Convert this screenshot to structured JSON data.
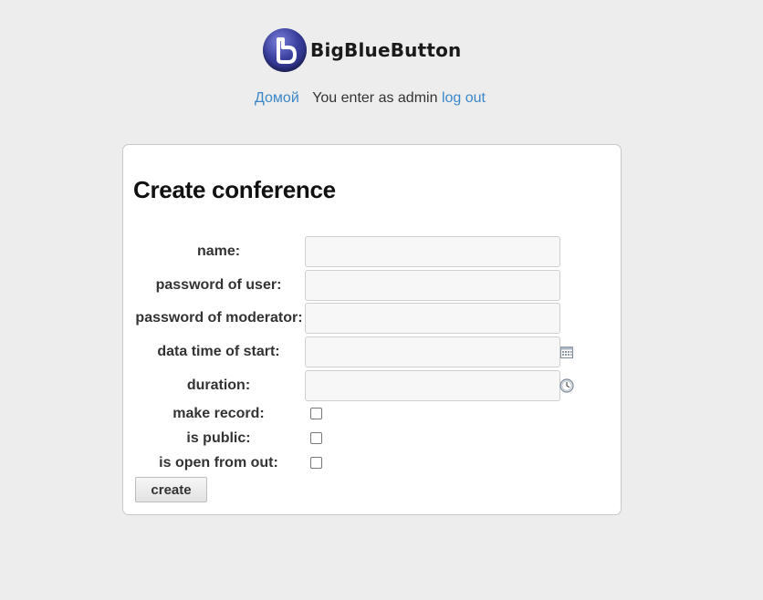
{
  "header": {
    "brand": "BigBlueButton",
    "logo_icon": "bigbluebutton-logo-icon"
  },
  "userbar": {
    "home_link": "Домой",
    "message": "You enter as admin",
    "logout_link": "log out"
  },
  "form": {
    "title": "Create conference",
    "fields": {
      "name": {
        "label": "name:",
        "value": ""
      },
      "user_password": {
        "label": "password of user:",
        "value": ""
      },
      "moderator_password": {
        "label": "password of moderator:",
        "value": ""
      },
      "start_datetime": {
        "label": "data time of start:",
        "value": "",
        "icon": "calendar-icon"
      },
      "duration": {
        "label": "duration:",
        "value": "",
        "icon": "clock-icon"
      }
    },
    "checkboxes": {
      "make_record": {
        "label": "make record:",
        "checked": false
      },
      "is_public": {
        "label": "is public:",
        "checked": false
      },
      "open_from_out": {
        "label": "is open from out:",
        "checked": false
      }
    },
    "submit_label": "create"
  }
}
